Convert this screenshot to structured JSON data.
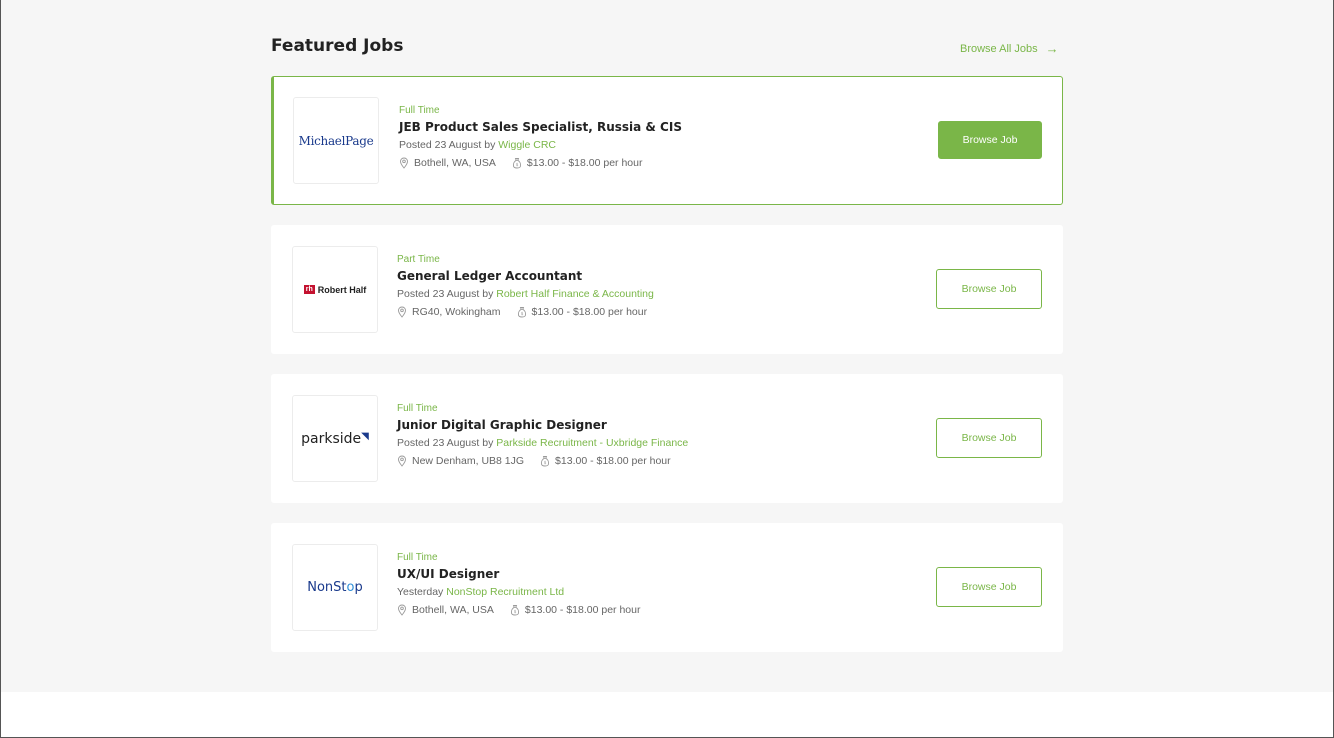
{
  "header": {
    "title": "Featured Jobs",
    "browse_all": "Browse All Jobs",
    "browse_all_arrow": "→"
  },
  "jobs": [
    {
      "type": "Full Time",
      "title": "JEB Product Sales Specialist, Russia & CIS",
      "posted_prefix": "Posted 23 August by",
      "company": "Wiggle CRC",
      "location": "Bothell, WA, USA",
      "salary": "$13.00 - $18.00 per hour",
      "button": "Browse Job",
      "logo_text": "MichaelPage",
      "featured": true
    },
    {
      "type": "Part Time",
      "title": "General Ledger Accountant",
      "posted_prefix": "Posted 23 August by",
      "company": "Robert Half Finance & Accounting",
      "location": "RG40, Wokingham",
      "salary": "$13.00 - $18.00 per hour",
      "button": "Browse Job",
      "logo_mark": "rh",
      "logo_text": "Robert Half"
    },
    {
      "type": "Full Time",
      "title": "Junior Digital Graphic Designer",
      "posted_prefix": "Posted 23 August by",
      "company": "Parkside Recruitment - Uxbridge Finance",
      "location": "New Denham, UB8 1JG",
      "salary": "$13.00 - $18.00 per hour",
      "button": "Browse Job",
      "logo_text": "parkside"
    },
    {
      "type": "Full Time",
      "title": "UX/UI Designer",
      "posted_prefix": "Yesterday",
      "company": "NonStop Recruitment Ltd",
      "location": "Bothell, WA, USA",
      "salary": "$13.00 - $18.00 per hour",
      "button": "Browse Job",
      "logo_text_a": "NonSt",
      "logo_text_b": "o",
      "logo_text_c": "p"
    }
  ],
  "colors": {
    "accent": "#7ab648",
    "background": "#f6f6f6",
    "card": "#ffffff"
  },
  "icons": {
    "location": "map-pin-icon",
    "salary": "money-bag-icon"
  }
}
